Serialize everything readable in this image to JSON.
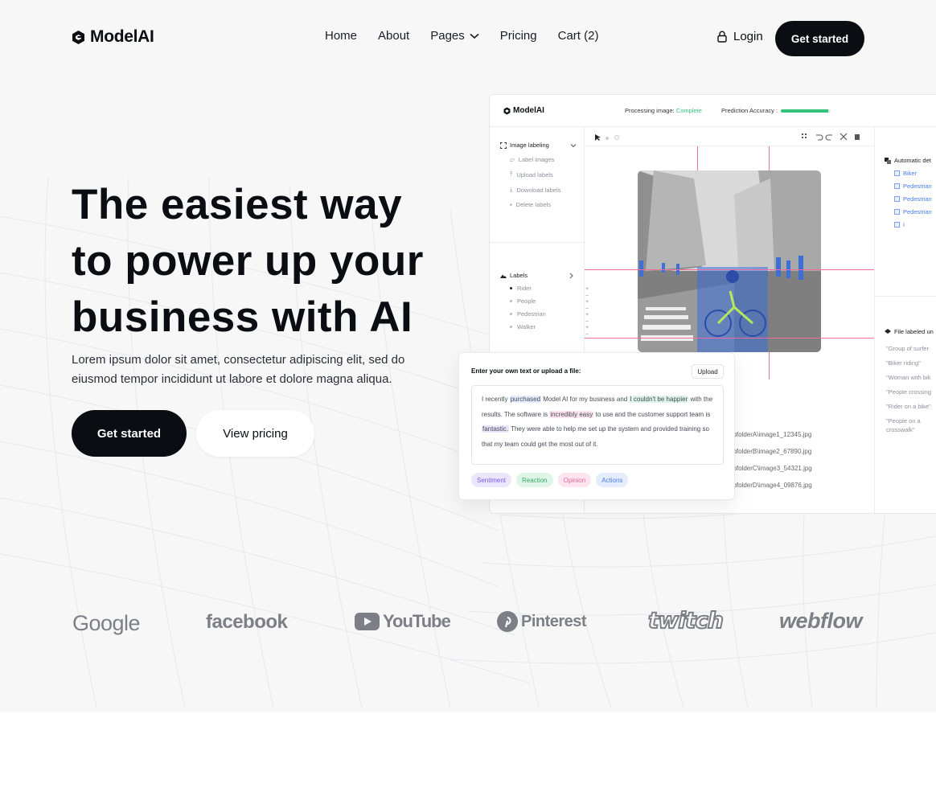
{
  "brand": {
    "name": "ModelAI"
  },
  "nav": {
    "links": [
      {
        "label": "Home"
      },
      {
        "label": "About"
      },
      {
        "label": "Pages"
      },
      {
        "label": "Pricing"
      },
      {
        "label": "Cart (2)"
      }
    ],
    "login_label": "Login",
    "cta_label": "Get started"
  },
  "hero": {
    "headline_lines": [
      "The easiest way",
      "to power up your",
      "business with AI"
    ],
    "subtext": "Lorem ipsum dolor sit amet, consectetur adipiscing elit, sed do eiusmod tempor incididunt ut labore et dolore magna aliqua.",
    "primary_button": "Get started",
    "secondary_button": "View pricing"
  },
  "app": {
    "logo": "ModelAI",
    "processing_label": "Processing image:",
    "processing_status": "Complete",
    "accuracy_label": "Prediction Accuracy :",
    "accuracy_value": 0.95,
    "sidebar": {
      "section_title": "Image labeling",
      "items": [
        "Label images",
        "Upload labels",
        "Download labels",
        "Delete labels"
      ],
      "labels_title": "Labels",
      "labels": [
        "Rider",
        "People",
        "Pedestrian",
        "Walker"
      ]
    },
    "files": [
      "ubfolderA\\image1_12345.jpg",
      "ubfolderB\\image2_67890.jpg",
      "ubfolderC\\image3_54321.jpg",
      "ubfolderD\\image4_09876.jpg"
    ],
    "right_panel": {
      "detect_title": "Automatic det",
      "detect_items": [
        "Biker",
        "Pedestrian",
        "Pedestrian",
        "Pedestrian",
        "I"
      ],
      "files_title": "File labeled un",
      "quotes": [
        "\"Group of surfer",
        "\"Biker riding\"",
        "\"Woman with bik",
        "\"People crossing",
        "\"Rider on a bike\"",
        "\"People on a crosswalk\""
      ]
    }
  },
  "text_card": {
    "title": "Enter your own text or upload a file:",
    "upload_label": "Upload",
    "segments": [
      {
        "text": "I recently ",
        "style": ""
      },
      {
        "text": "purchased",
        "style": "hl-blue"
      },
      {
        "text": " Model AI for my business and ",
        "style": ""
      },
      {
        "text": "I couldn't be happier",
        "style": "hl-green"
      },
      {
        "text": " with the results. The software is ",
        "style": ""
      },
      {
        "text": "incredibly easy",
        "style": "hl-pink"
      },
      {
        "text": " to use and the customer support team is ",
        "style": ""
      },
      {
        "text": "fantastic.",
        "style": "hl-purple"
      },
      {
        "text": " They were able to help me set up the system and provided training so that my team could get the most out of it.",
        "style": ""
      }
    ],
    "tags": [
      "Sentiment",
      "Reaction",
      "Opinion",
      "Actions"
    ]
  },
  "logos": [
    "Google",
    "facebook",
    "YouTube",
    "Pinterest",
    "twitch",
    "webflow"
  ],
  "colors": {
    "dark": "#0a0d12",
    "accent_green": "#34c27a",
    "guide_pink": "#f06aa0",
    "highlight_blue": "#4a7de8"
  }
}
